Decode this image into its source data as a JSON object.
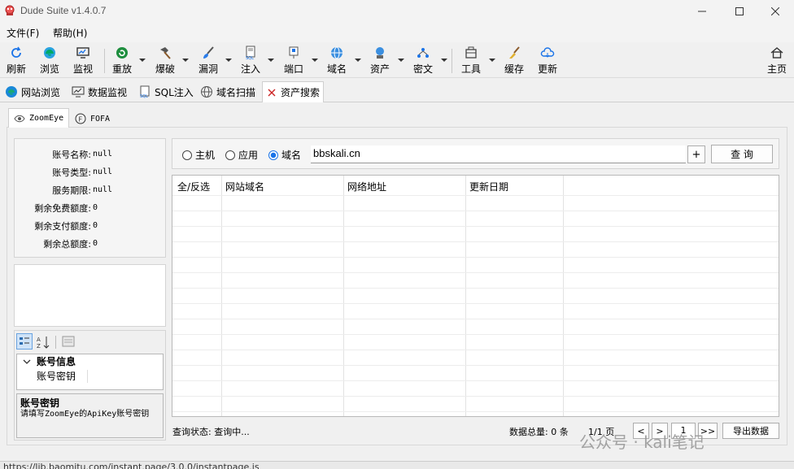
{
  "window": {
    "title": "Dude Suite v1.4.0.7"
  },
  "menu": {
    "file": "文件(F)",
    "help": "帮助(H)"
  },
  "toolbar": {
    "refresh": "刷新",
    "browse": "浏览",
    "monitor": "监视",
    "replay": "重放",
    "brute": "爆破",
    "vuln": "漏洞",
    "inject": "注入",
    "port": "端口",
    "domain": "域名",
    "asset": "资产",
    "cipher": "密文",
    "tools": "工具",
    "cache": "缓存",
    "update": "更新",
    "home": "主页"
  },
  "doc_tabs": [
    "网站浏览",
    "数据监视",
    "SQL注入",
    "域名扫描",
    "资产搜索"
  ],
  "inner_tabs": [
    "ZoomEye",
    "FOFA"
  ],
  "account": [
    {
      "key": "账号名称:",
      "value": "null"
    },
    {
      "key": "账号类型:",
      "value": "null"
    },
    {
      "key": "服务期限:",
      "value": "null"
    },
    {
      "key": "剩余免费额度:",
      "value": "0"
    },
    {
      "key": "剩余支付额度:",
      "value": "0"
    },
    {
      "key": "剩余总额度:",
      "value": "0"
    }
  ],
  "propgrid": {
    "category": "账号信息",
    "prop_name": "账号密钥",
    "desc_title": "账号密钥",
    "desc_text": "请填写ZoomEye的ApiKey账号密钥"
  },
  "search": {
    "radio_host": "主机",
    "radio_app": "应用",
    "radio_domain": "域名",
    "selected": "域名",
    "query": "bbskali.cn",
    "plus": "+",
    "button": "查 询"
  },
  "table": {
    "headers": [
      "全/反选",
      "网站域名",
      "网络地址",
      "更新日期"
    ],
    "rows": []
  },
  "status": {
    "query_status": "查询状态: 查询中...",
    "total_label": "数据总量: 0 条",
    "page_label": "1/1 页",
    "prev": "<",
    "next": ">",
    "page_input": "1",
    "last": ">>",
    "export": "导出数据"
  },
  "watermark": "公众号 · kali笔记",
  "statusbar_url": "https://lib.baomitu.com/instant.page/3.0.0/instantpage.js"
}
